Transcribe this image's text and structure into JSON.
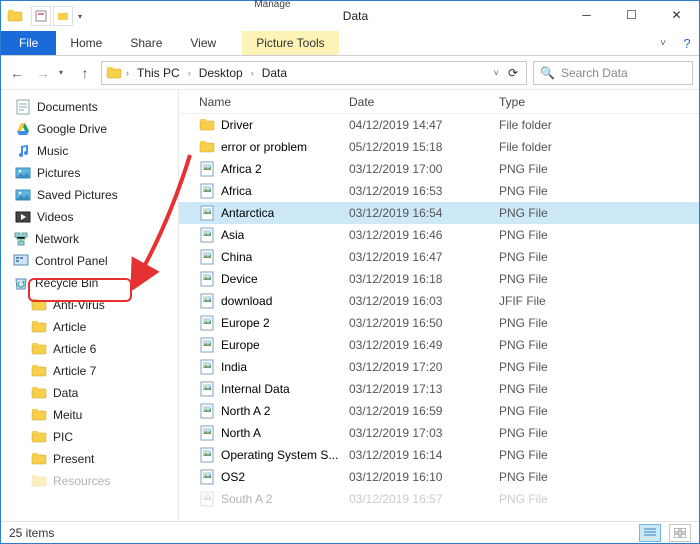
{
  "titlebar": {
    "context_header": "Manage",
    "context_tab": "Picture Tools",
    "title": "Data"
  },
  "ribbon": {
    "file": "File",
    "tabs": [
      "Home",
      "Share",
      "View"
    ],
    "ctx_tab": "Picture Tools"
  },
  "nav": {
    "breadcrumbs": [
      "This PC",
      "Desktop",
      "Data"
    ],
    "search_placeholder": "Search Data"
  },
  "tree": [
    {
      "icon": "doc",
      "label": "Documents",
      "sub": false
    },
    {
      "icon": "gdrive",
      "label": "Google Drive",
      "sub": false
    },
    {
      "icon": "music",
      "label": "Music",
      "sub": false
    },
    {
      "icon": "pic",
      "label": "Pictures",
      "sub": false
    },
    {
      "icon": "pic",
      "label": "Saved Pictures",
      "sub": false
    },
    {
      "icon": "video",
      "label": "Videos",
      "sub": false
    },
    {
      "icon": "network",
      "label": "Network",
      "sub": false,
      "outdent": true
    },
    {
      "icon": "cpanel",
      "label": "Control Panel",
      "sub": false,
      "outdent": true
    },
    {
      "icon": "recycle",
      "label": "Recycle Bin",
      "sub": false,
      "outdent": true,
      "highlight": true
    },
    {
      "icon": "folder",
      "label": "Anti-Virus",
      "sub": true
    },
    {
      "icon": "folder",
      "label": "Article",
      "sub": true
    },
    {
      "icon": "folder",
      "label": "Article 6",
      "sub": true
    },
    {
      "icon": "folder",
      "label": "Article 7",
      "sub": true
    },
    {
      "icon": "folder",
      "label": "Data",
      "sub": true
    },
    {
      "icon": "folder",
      "label": "Meitu",
      "sub": true
    },
    {
      "icon": "folder",
      "label": "PIC",
      "sub": true
    },
    {
      "icon": "folder",
      "label": "Present",
      "sub": true
    },
    {
      "icon": "folder",
      "label": "Resources",
      "sub": true,
      "cutoff": true
    }
  ],
  "columns": {
    "name": "Name",
    "date": "Date",
    "type": "Type"
  },
  "rows": [
    {
      "icon": "folder",
      "name": "Driver",
      "date": "04/12/2019 14:47",
      "type": "File folder"
    },
    {
      "icon": "folder",
      "name": "error or problem",
      "date": "05/12/2019 15:18",
      "type": "File folder"
    },
    {
      "icon": "png",
      "name": "Africa 2",
      "date": "03/12/2019 17:00",
      "type": "PNG File"
    },
    {
      "icon": "png",
      "name": "Africa",
      "date": "03/12/2019 16:53",
      "type": "PNG File"
    },
    {
      "icon": "png",
      "name": "Antarctica",
      "date": "03/12/2019 16:54",
      "type": "PNG File",
      "selected": true
    },
    {
      "icon": "png",
      "name": "Asia",
      "date": "03/12/2019 16:46",
      "type": "PNG File"
    },
    {
      "icon": "png",
      "name": "China",
      "date": "03/12/2019 16:47",
      "type": "PNG File"
    },
    {
      "icon": "png",
      "name": "Device",
      "date": "03/12/2019 16:18",
      "type": "PNG File"
    },
    {
      "icon": "jfif",
      "name": "download",
      "date": "03/12/2019 16:03",
      "type": "JFIF File"
    },
    {
      "icon": "png",
      "name": "Europe 2",
      "date": "03/12/2019 16:50",
      "type": "PNG File"
    },
    {
      "icon": "png",
      "name": "Europe",
      "date": "03/12/2019 16:49",
      "type": "PNG File"
    },
    {
      "icon": "png",
      "name": "India",
      "date": "03/12/2019 17:20",
      "type": "PNG File"
    },
    {
      "icon": "png",
      "name": "Internal Data",
      "date": "03/12/2019 17:13",
      "type": "PNG File"
    },
    {
      "icon": "png",
      "name": "North A 2",
      "date": "03/12/2019 16:59",
      "type": "PNG File"
    },
    {
      "icon": "png",
      "name": "North A",
      "date": "03/12/2019 17:03",
      "type": "PNG File"
    },
    {
      "icon": "png",
      "name": "Operating System S...",
      "date": "03/12/2019 16:14",
      "type": "PNG File"
    },
    {
      "icon": "png",
      "name": "OS2",
      "date": "03/12/2019 16:10",
      "type": "PNG File"
    },
    {
      "icon": "png",
      "name": "South A 2",
      "date": "03/12/2019 16:57",
      "type": "PNG File",
      "cutoff": true
    }
  ],
  "status": {
    "count": "25 items"
  }
}
